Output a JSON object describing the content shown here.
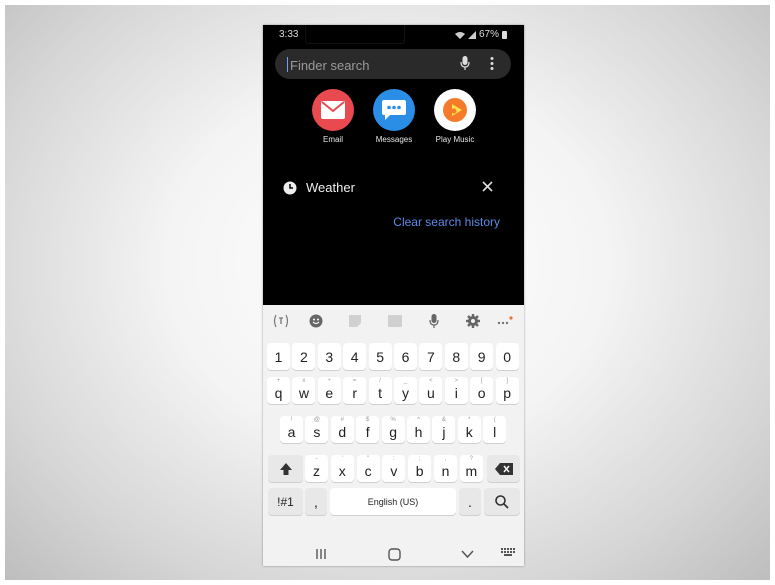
{
  "status": {
    "time": "3:33",
    "battery": "67%"
  },
  "search": {
    "placeholder": "Finder search"
  },
  "apps": [
    {
      "label": "Email",
      "color": "#e84a4f"
    },
    {
      "label": "Messages",
      "color": "#2b8ee6"
    },
    {
      "label": "Play Music",
      "color": "#f57b2b"
    }
  ],
  "history": {
    "item": "Weather",
    "clear_label": "Clear search history"
  },
  "keyboard": {
    "numbers": [
      "1",
      "2",
      "3",
      "4",
      "5",
      "6",
      "7",
      "8",
      "9",
      "0"
    ],
    "row1": [
      "q",
      "w",
      "e",
      "r",
      "t",
      "y",
      "u",
      "i",
      "o",
      "p"
    ],
    "row1_hints": [
      "+",
      "x",
      "÷",
      "=",
      "/",
      "_",
      "<",
      ">",
      "[",
      "]"
    ],
    "row2": [
      "a",
      "s",
      "d",
      "f",
      "g",
      "h",
      "j",
      "k",
      "l"
    ],
    "row2_hints": [
      "!",
      "@",
      "#",
      "$",
      "%",
      "^",
      "&",
      "*",
      "("
    ],
    "row3": [
      "z",
      "x",
      "c",
      "v",
      "b",
      "n",
      "m"
    ],
    "row3_hints": [
      "-",
      "'",
      "\"",
      ":",
      ";",
      ",",
      "?"
    ],
    "symbols_label": "!#1",
    "comma": ",",
    "space_label": "English (US)",
    "period": "."
  }
}
